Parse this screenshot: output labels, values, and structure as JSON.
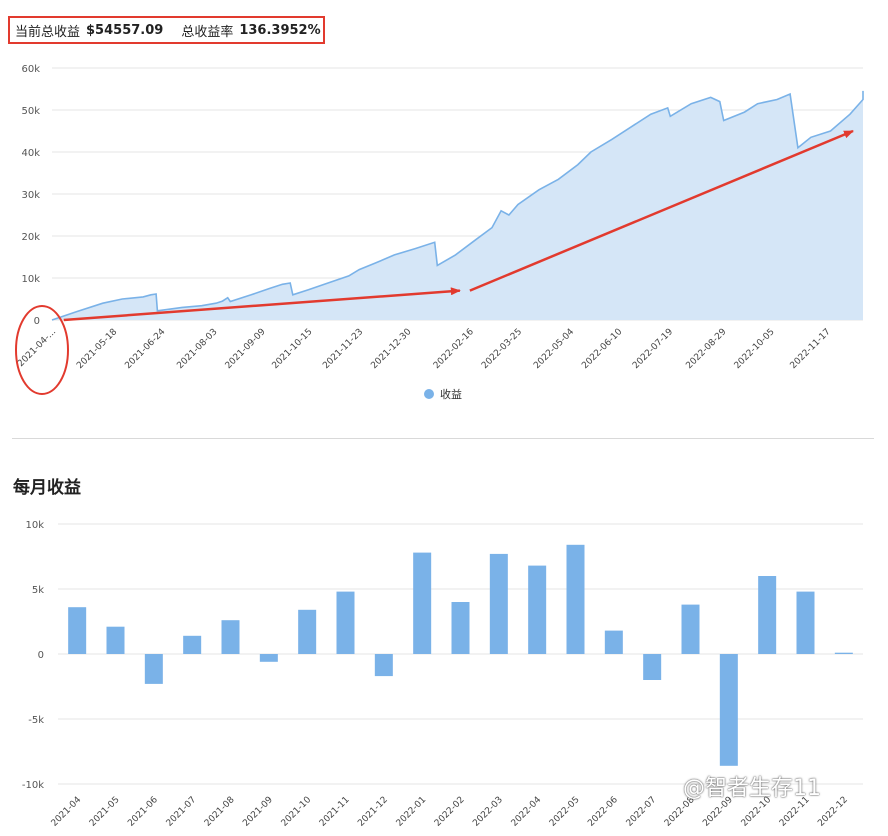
{
  "summary": {
    "total_label": "当前总收益",
    "total_value": "$54557.09",
    "rate_label": "总收益率",
    "rate_value": "136.3952%"
  },
  "legend_label": "收益",
  "monthly_title": "每月收益",
  "watermark": "@智者生存11",
  "colors": {
    "line": "#7ab2e8",
    "area": "#d5e6f7",
    "bar": "#7ab2e8",
    "annotation": "#e23a2e",
    "grid": "#e6e6e6"
  },
  "chart_data": [
    {
      "type": "area",
      "series_name": "收益",
      "ylim": [
        0,
        60000
      ],
      "yticks": [
        "0",
        "10k",
        "20k",
        "30k",
        "40k",
        "50k",
        "60k"
      ],
      "ytick_values": [
        0,
        10000,
        20000,
        30000,
        40000,
        50000,
        60000
      ],
      "xlim": [
        "2021-04-01",
        "2022-12-15"
      ],
      "x_tick_labels": [
        "2021-04-...",
        "2021-05-18",
        "2021-06-24",
        "2021-08-03",
        "2021-09-09",
        "2021-10-15",
        "2021-11-23",
        "2021-12-30",
        "2022-02-16",
        "2022-03-25",
        "2022-05-04",
        "2022-06-10",
        "2022-07-19",
        "2022-08-29",
        "2022-10-05",
        "2022-11-17"
      ],
      "x_tick_dates": [
        "2021-04-01",
        "2021-05-18",
        "2021-06-24",
        "2021-08-03",
        "2021-09-09",
        "2021-10-15",
        "2021-11-23",
        "2021-12-30",
        "2022-02-16",
        "2022-03-25",
        "2022-05-04",
        "2022-06-10",
        "2022-07-19",
        "2022-08-29",
        "2022-10-05",
        "2022-11-17"
      ],
      "points": [
        [
          "2021-04-01",
          0
        ],
        [
          "2021-04-20",
          2000
        ],
        [
          "2021-05-10",
          4000
        ],
        [
          "2021-05-25",
          5000
        ],
        [
          "2021-06-10",
          5500
        ],
        [
          "2021-06-16",
          6000
        ],
        [
          "2021-06-20",
          6200
        ],
        [
          "2021-06-21",
          2200
        ],
        [
          "2021-07-10",
          3000
        ],
        [
          "2021-07-25",
          3400
        ],
        [
          "2021-08-05",
          4000
        ],
        [
          "2021-08-10",
          4500
        ],
        [
          "2021-08-14",
          5300
        ],
        [
          "2021-08-16",
          4400
        ],
        [
          "2021-09-01",
          6000
        ],
        [
          "2021-09-15",
          7500
        ],
        [
          "2021-09-25",
          8500
        ],
        [
          "2021-10-01",
          8800
        ],
        [
          "2021-10-03",
          6000
        ],
        [
          "2021-10-15",
          7200
        ],
        [
          "2021-10-30",
          8800
        ],
        [
          "2021-11-15",
          10500
        ],
        [
          "2021-11-23",
          12000
        ],
        [
          "2021-12-05",
          13500
        ],
        [
          "2021-12-20",
          15500
        ],
        [
          "2022-01-05",
          17000
        ],
        [
          "2022-01-20",
          18500
        ],
        [
          "2022-01-22",
          13000
        ],
        [
          "2022-02-05",
          15500
        ],
        [
          "2022-02-20",
          19000
        ],
        [
          "2022-03-05",
          22000
        ],
        [
          "2022-03-12",
          26000
        ],
        [
          "2022-03-18",
          25000
        ],
        [
          "2022-03-25",
          27500
        ],
        [
          "2022-04-10",
          31000
        ],
        [
          "2022-04-25",
          33500
        ],
        [
          "2022-05-10",
          37000
        ],
        [
          "2022-05-20",
          40000
        ],
        [
          "2022-06-05",
          43000
        ],
        [
          "2022-06-20",
          46000
        ],
        [
          "2022-07-05",
          49000
        ],
        [
          "2022-07-18",
          50500
        ],
        [
          "2022-07-20",
          48500
        ],
        [
          "2022-08-05",
          51500
        ],
        [
          "2022-08-20",
          53000
        ],
        [
          "2022-08-27",
          52000
        ],
        [
          "2022-08-30",
          47500
        ],
        [
          "2022-09-15",
          49500
        ],
        [
          "2022-09-25",
          51500
        ],
        [
          "2022-10-10",
          52500
        ],
        [
          "2022-10-20",
          53800
        ],
        [
          "2022-10-26",
          41000
        ],
        [
          "2022-11-05",
          43500
        ],
        [
          "2022-11-20",
          45000
        ],
        [
          "2022-12-05",
          49000
        ],
        [
          "2022-12-15",
          52500
        ],
        [
          "2022-12-25",
          53500
        ],
        [
          "2023-01-10",
          54557
        ]
      ],
      "annotations": [
        {
          "type": "arrow",
          "from": [
            "2021-04-10",
            0
          ],
          "to": [
            "2022-02-16",
            7000
          ]
        },
        {
          "type": "arrow",
          "from": [
            "2022-02-16",
            7000
          ],
          "to": [
            "2023-01-10",
            45000
          ]
        },
        {
          "type": "circle",
          "around": "2021-04-..."
        }
      ]
    },
    {
      "type": "bar",
      "title": "每月收益",
      "ylim": [
        -10000,
        10000
      ],
      "yticks": [
        "-10k",
        "-5k",
        "0",
        "5k",
        "10k"
      ],
      "ytick_values": [
        -10000,
        -5000,
        0,
        5000,
        10000
      ],
      "categories": [
        "2021-04",
        "2021-05",
        "2021-06",
        "2021-07",
        "2021-08",
        "2021-09",
        "2021-10",
        "2021-11",
        "2021-12",
        "2022-01",
        "2022-02",
        "2022-03",
        "2022-04",
        "2022-05",
        "2022-06",
        "2022-07",
        "2022-08",
        "2022-09",
        "2022-10",
        "2022-11",
        "2022-12"
      ],
      "category_labels": [
        "2021-04",
        "2021-05",
        "2021-06",
        "2021-07",
        "2021-08",
        "2021-09",
        "2021-10",
        "2021-11",
        "2021-12",
        "2022-01",
        "2022-02",
        "2022-03",
        "2022-04",
        "2022-05",
        "2022-06",
        "2022-07",
        "2022-08",
        "2022-09",
        "2022-10",
        "2022-11",
        "2022-12"
      ],
      "values": [
        3600,
        2100,
        -2300,
        1400,
        2600,
        -600,
        3400,
        4800,
        -1700,
        7800,
        4000,
        7700,
        6800,
        8400,
        1800,
        -2000,
        3800,
        -8600,
        6000,
        4800,
        100
      ]
    }
  ]
}
